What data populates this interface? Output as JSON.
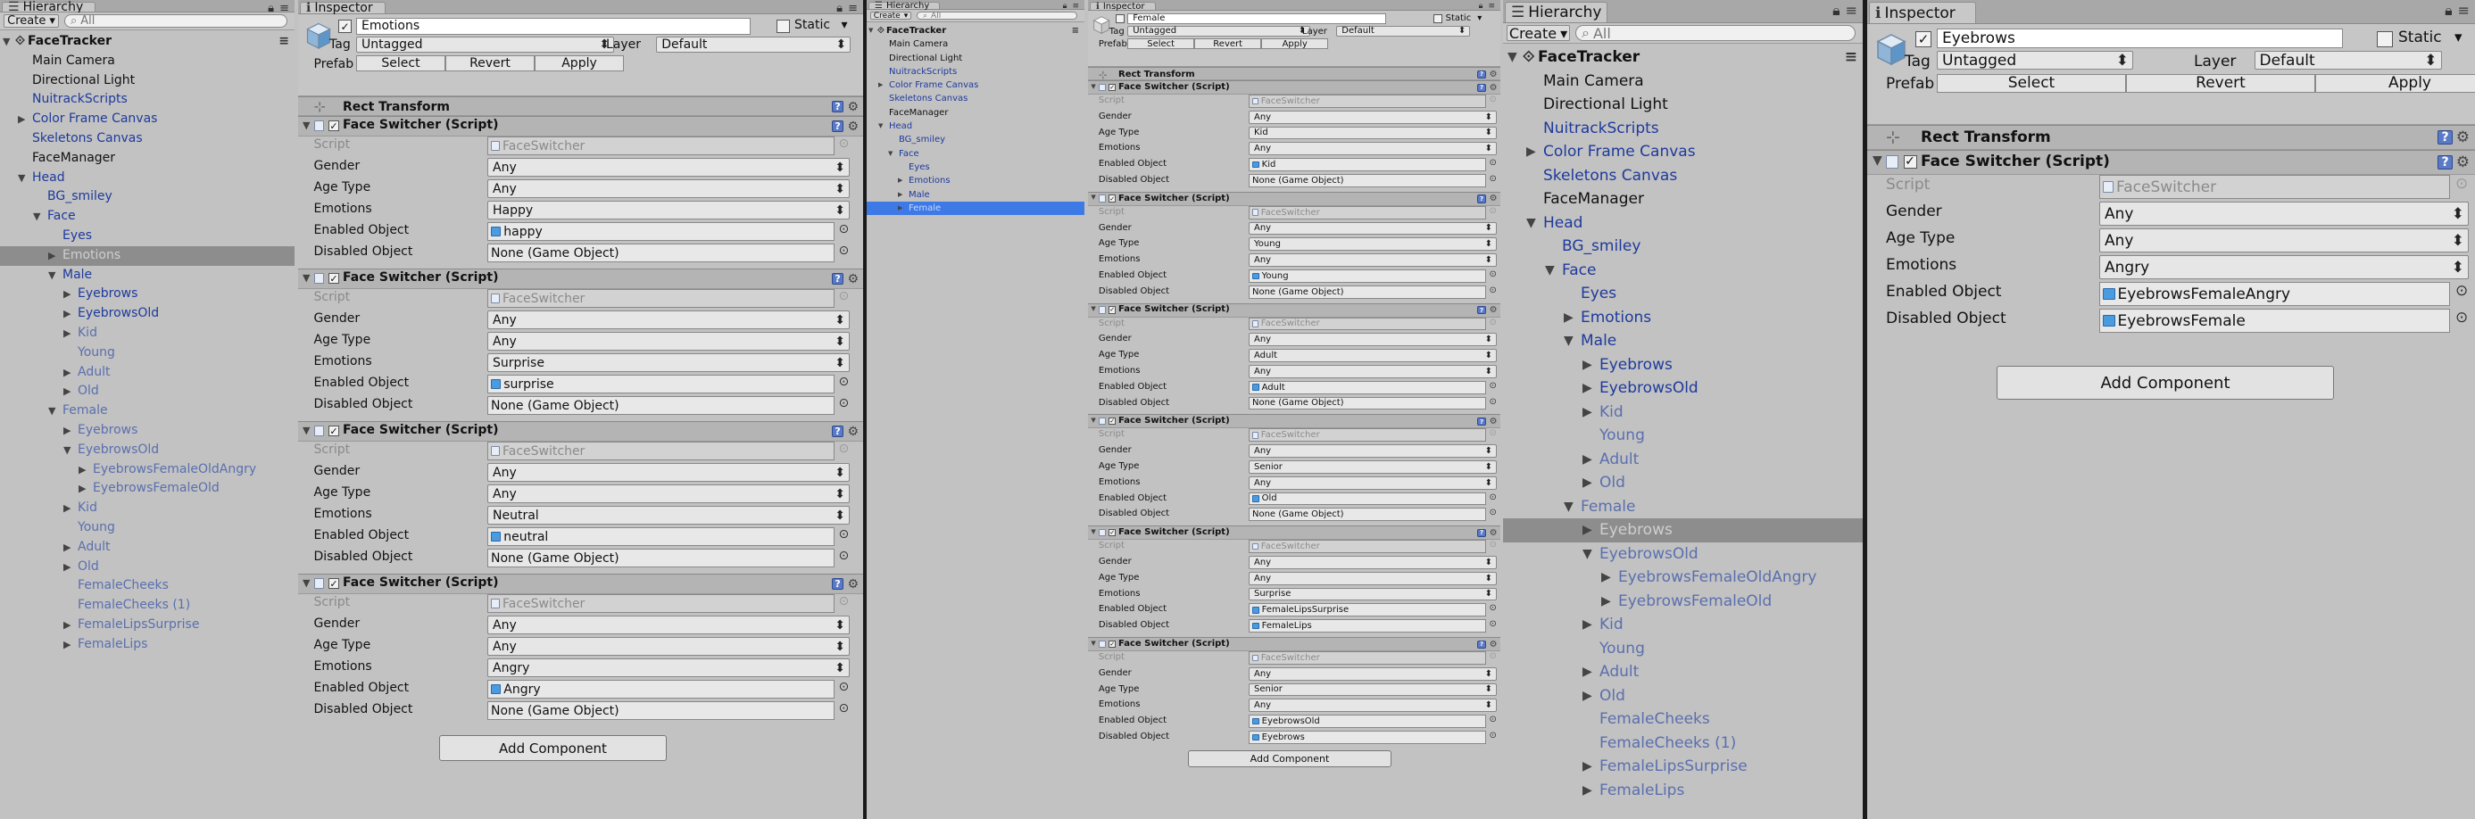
{
  "hierarchy_tab": "Hierarchy",
  "inspector_tab": "Inspector",
  "create_label": "Create",
  "search_placeholder": "All",
  "dropdown_arrow": "▾",
  "labels": {
    "static": "Static",
    "tag": "Tag",
    "layer": "Layer",
    "prefab": "Prefab",
    "select": "Select",
    "revert": "Revert",
    "apply": "Apply",
    "script": "Script",
    "gender": "Gender",
    "age_type": "Age Type",
    "emotions": "Emotions",
    "enabled_object": "Enabled Object",
    "disabled_object": "Disabled Object",
    "rect_transform": "Rect Transform",
    "face_switcher": "Face Switcher (Script)",
    "script_value": "FaceSwitcher",
    "add_component": "Add Component",
    "tag_value": "Untagged",
    "layer_value": "Default",
    "none_go": "None (Game Object)"
  },
  "h1_tree": [
    {
      "t": "FaceTracker",
      "d": 0,
      "a": "open",
      "s": "root"
    },
    {
      "t": "Main Camera",
      "d": 1,
      "a": "",
      "s": ""
    },
    {
      "t": "Directional Light",
      "d": 1,
      "a": "",
      "s": ""
    },
    {
      "t": "NuitrackScripts",
      "d": 1,
      "a": "",
      "s": "prefab"
    },
    {
      "t": "Color Frame Canvas",
      "d": 1,
      "a": "closed",
      "s": "prefab"
    },
    {
      "t": "Skeletons Canvas",
      "d": 1,
      "a": "",
      "s": "prefab"
    },
    {
      "t": "FaceManager",
      "d": 1,
      "a": "",
      "s": ""
    },
    {
      "t": "Head",
      "d": 1,
      "a": "open",
      "s": "prefab"
    },
    {
      "t": "BG_smiley",
      "d": 2,
      "a": "",
      "s": "prefab"
    },
    {
      "t": "Face",
      "d": 2,
      "a": "open",
      "s": "prefab"
    },
    {
      "t": "Eyes",
      "d": 3,
      "a": "",
      "s": "prefab"
    },
    {
      "t": "Emotions",
      "d": 3,
      "a": "closed",
      "s": "selgray"
    },
    {
      "t": "Male",
      "d": 3,
      "a": "open",
      "s": "prefab"
    },
    {
      "t": "Eyebrows",
      "d": 4,
      "a": "closed",
      "s": "prefab"
    },
    {
      "t": "EyebrowsOld",
      "d": 4,
      "a": "closed",
      "s": "prefab"
    },
    {
      "t": "Kid",
      "d": 4,
      "a": "closed",
      "s": "dimprefab"
    },
    {
      "t": "Young",
      "d": 4,
      "a": "",
      "s": "dimprefab"
    },
    {
      "t": "Adult",
      "d": 4,
      "a": "closed",
      "s": "dimprefab"
    },
    {
      "t": "Old",
      "d": 4,
      "a": "closed",
      "s": "dimprefab"
    },
    {
      "t": "Female",
      "d": 3,
      "a": "open",
      "s": "dimprefab"
    },
    {
      "t": "Eyebrows",
      "d": 4,
      "a": "closed",
      "s": "dimprefab"
    },
    {
      "t": "EyebrowsOld",
      "d": 4,
      "a": "open",
      "s": "dimprefab"
    },
    {
      "t": "EyebrowsFemaleOldAngry",
      "d": 5,
      "a": "closed",
      "s": "dimprefab"
    },
    {
      "t": "EyebrowsFemaleOld",
      "d": 5,
      "a": "closed",
      "s": "dimprefab"
    },
    {
      "t": "Kid",
      "d": 4,
      "a": "closed",
      "s": "dimprefab"
    },
    {
      "t": "Young",
      "d": 4,
      "a": "",
      "s": "dimprefab"
    },
    {
      "t": "Adult",
      "d": 4,
      "a": "closed",
      "s": "dimprefab"
    },
    {
      "t": "Old",
      "d": 4,
      "a": "closed",
      "s": "dimprefab"
    },
    {
      "t": "FemaleCheeks",
      "d": 4,
      "a": "",
      "s": "dimprefab"
    },
    {
      "t": "FemaleCheeks (1)",
      "d": 4,
      "a": "",
      "s": "dimprefab"
    },
    {
      "t": "FemaleLipsSurprise",
      "d": 4,
      "a": "closed",
      "s": "dimprefab"
    },
    {
      "t": "FemaleLips",
      "d": 4,
      "a": "closed",
      "s": "dimprefab"
    }
  ],
  "h2_tree": [
    {
      "t": "FaceTracker",
      "d": 0,
      "a": "open",
      "s": "root"
    },
    {
      "t": "Main Camera",
      "d": 1,
      "a": "",
      "s": ""
    },
    {
      "t": "Directional Light",
      "d": 1,
      "a": "",
      "s": ""
    },
    {
      "t": "NuitrackScripts",
      "d": 1,
      "a": "",
      "s": "prefab"
    },
    {
      "t": "Color Frame Canvas",
      "d": 1,
      "a": "closed",
      "s": "prefab"
    },
    {
      "t": "Skeletons Canvas",
      "d": 1,
      "a": "",
      "s": "prefab"
    },
    {
      "t": "FaceManager",
      "d": 1,
      "a": "",
      "s": ""
    },
    {
      "t": "Head",
      "d": 1,
      "a": "open",
      "s": "prefab"
    },
    {
      "t": "BG_smiley",
      "d": 2,
      "a": "",
      "s": "prefab"
    },
    {
      "t": "Face",
      "d": 2,
      "a": "open",
      "s": "prefab"
    },
    {
      "t": "Eyes",
      "d": 3,
      "a": "",
      "s": "prefab"
    },
    {
      "t": "Emotions",
      "d": 3,
      "a": "closed",
      "s": "prefab"
    },
    {
      "t": "Male",
      "d": 3,
      "a": "closed",
      "s": "prefab"
    },
    {
      "t": "Female",
      "d": 3,
      "a": "closed",
      "s": "selblue"
    }
  ],
  "h3_tree": [
    {
      "t": "FaceTracker",
      "d": 0,
      "a": "open",
      "s": "root"
    },
    {
      "t": "Main Camera",
      "d": 1,
      "a": "",
      "s": ""
    },
    {
      "t": "Directional Light",
      "d": 1,
      "a": "",
      "s": ""
    },
    {
      "t": "NuitrackScripts",
      "d": 1,
      "a": "",
      "s": "prefab"
    },
    {
      "t": "Color Frame Canvas",
      "d": 1,
      "a": "closed",
      "s": "prefab"
    },
    {
      "t": "Skeletons Canvas",
      "d": 1,
      "a": "",
      "s": "prefab"
    },
    {
      "t": "FaceManager",
      "d": 1,
      "a": "",
      "s": ""
    },
    {
      "t": "Head",
      "d": 1,
      "a": "open",
      "s": "prefab"
    },
    {
      "t": "BG_smiley",
      "d": 2,
      "a": "",
      "s": "prefab"
    },
    {
      "t": "Face",
      "d": 2,
      "a": "open",
      "s": "prefab"
    },
    {
      "t": "Eyes",
      "d": 3,
      "a": "",
      "s": "prefab"
    },
    {
      "t": "Emotions",
      "d": 3,
      "a": "closed",
      "s": "prefab"
    },
    {
      "t": "Male",
      "d": 3,
      "a": "open",
      "s": "prefab"
    },
    {
      "t": "Eyebrows",
      "d": 4,
      "a": "closed",
      "s": "prefab"
    },
    {
      "t": "EyebrowsOld",
      "d": 4,
      "a": "closed",
      "s": "prefab"
    },
    {
      "t": "Kid",
      "d": 4,
      "a": "closed",
      "s": "dimprefab"
    },
    {
      "t": "Young",
      "d": 4,
      "a": "",
      "s": "dimprefab"
    },
    {
      "t": "Adult",
      "d": 4,
      "a": "closed",
      "s": "dimprefab"
    },
    {
      "t": "Old",
      "d": 4,
      "a": "closed",
      "s": "dimprefab"
    },
    {
      "t": "Female",
      "d": 3,
      "a": "open",
      "s": "dimprefab"
    },
    {
      "t": "Eyebrows",
      "d": 4,
      "a": "closed",
      "s": "selgray"
    },
    {
      "t": "EyebrowsOld",
      "d": 4,
      "a": "open",
      "s": "dimprefab"
    },
    {
      "t": "EyebrowsFemaleOldAngry",
      "d": 5,
      "a": "closed",
      "s": "dimprefab"
    },
    {
      "t": "EyebrowsFemaleOld",
      "d": 5,
      "a": "closed",
      "s": "dimprefab"
    },
    {
      "t": "Kid",
      "d": 4,
      "a": "closed",
      "s": "dimprefab"
    },
    {
      "t": "Young",
      "d": 4,
      "a": "",
      "s": "dimprefab"
    },
    {
      "t": "Adult",
      "d": 4,
      "a": "closed",
      "s": "dimprefab"
    },
    {
      "t": "Old",
      "d": 4,
      "a": "closed",
      "s": "dimprefab"
    },
    {
      "t": "FemaleCheeks",
      "d": 4,
      "a": "",
      "s": "dimprefab"
    },
    {
      "t": "FemaleCheeks (1)",
      "d": 4,
      "a": "",
      "s": "dimprefab"
    },
    {
      "t": "FemaleLipsSurprise",
      "d": 4,
      "a": "closed",
      "s": "dimprefab"
    },
    {
      "t": "FemaleLips",
      "d": 4,
      "a": "closed",
      "s": "dimprefab"
    }
  ],
  "i1": {
    "object_name": "Emotions",
    "components": [
      {
        "gender": "Any",
        "age": "Any",
        "emotion": "Happy",
        "enabled": "happy",
        "disabled": "None (Game Object)"
      },
      {
        "gender": "Any",
        "age": "Any",
        "emotion": "Surprise",
        "enabled": "surprise",
        "disabled": "None (Game Object)"
      },
      {
        "gender": "Any",
        "age": "Any",
        "emotion": "Neutral",
        "enabled": "neutral",
        "disabled": "None (Game Object)"
      },
      {
        "gender": "Any",
        "age": "Any",
        "emotion": "Angry",
        "enabled": "Angry",
        "disabled": "None (Game Object)"
      }
    ]
  },
  "i2": {
    "object_name": "Female",
    "components": [
      {
        "gender": "Any",
        "age": "Kid",
        "emotion": "Any",
        "enabled": "Kid",
        "disabled": "None (Game Object)"
      },
      {
        "gender": "Any",
        "age": "Young",
        "emotion": "Any",
        "enabled": "Young",
        "disabled": "None (Game Object)"
      },
      {
        "gender": "Any",
        "age": "Adult",
        "emotion": "Any",
        "enabled": "Adult",
        "disabled": "None (Game Object)"
      },
      {
        "gender": "Any",
        "age": "Senior",
        "emotion": "Any",
        "enabled": "Old",
        "disabled": "None (Game Object)"
      },
      {
        "gender": "Any",
        "age": "Any",
        "emotion": "Surprise",
        "enabled": "FemaleLipsSurprise",
        "disabled": "FemaleLips"
      },
      {
        "gender": "Any",
        "age": "Senior",
        "emotion": "Any",
        "enabled": "EyebrowsOld",
        "disabled": "Eyebrows"
      }
    ]
  },
  "i3": {
    "object_name": "Eyebrows",
    "components": [
      {
        "gender": "Any",
        "age": "Any",
        "emotion": "Angry",
        "enabled": "EyebrowsFemaleAngry",
        "disabled": "EyebrowsFemale"
      }
    ]
  }
}
